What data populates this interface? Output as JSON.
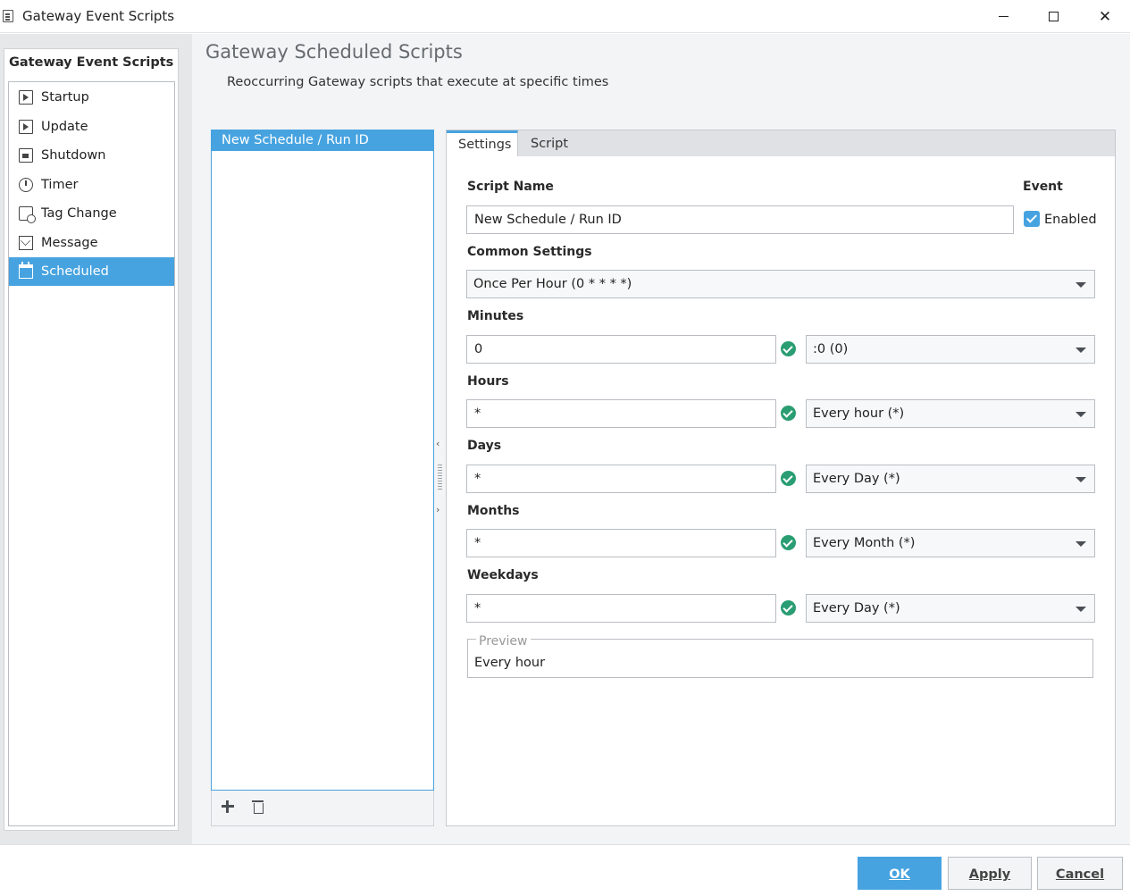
{
  "window": {
    "title": "Gateway Event Scripts",
    "close_glyph": "✕"
  },
  "sidebar": {
    "header": "Gateway Event Scripts",
    "items": [
      {
        "label": "Startup",
        "icon": "play-document-icon"
      },
      {
        "label": "Update",
        "icon": "play-document-icon"
      },
      {
        "label": "Shutdown",
        "icon": "stop-document-icon"
      },
      {
        "label": "Timer",
        "icon": "timer-icon"
      },
      {
        "label": "Tag Change",
        "icon": "tag-icon"
      },
      {
        "label": "Message",
        "icon": "envelope-icon"
      },
      {
        "label": "Scheduled",
        "icon": "calendar-icon",
        "selected": true
      }
    ]
  },
  "header": {
    "title": "Gateway Scheduled Scripts",
    "subtitle": "Reoccurring Gateway scripts that execute at specific times"
  },
  "schedule_list": {
    "items": [
      "New Schedule / Run ID"
    ],
    "toolbar": {
      "add_icon": "plus-icon",
      "delete_icon": "trash-icon"
    }
  },
  "splitter": {
    "left_arrow": "‹",
    "right_arrow": "›"
  },
  "tabs": [
    "Settings",
    "Script"
  ],
  "settings": {
    "script_name_label": "Script Name",
    "script_name_value": "New Schedule / Run ID",
    "event_label": "Event",
    "enabled_label": "Enabled",
    "enabled": true,
    "common_label": "Common Settings",
    "common_value": "Once Per Hour (0 * * * *)",
    "minutes_label": "Minutes",
    "minutes_value": "0",
    "minutes_combo": ":0 (0)",
    "hours_label": "Hours",
    "hours_value": "*",
    "hours_combo": "Every hour (*)",
    "days_label": "Days",
    "days_value": "*",
    "days_combo": "Every Day (*)",
    "months_label": "Months",
    "months_value": "*",
    "months_combo": "Every Month (*)",
    "weekdays_label": "Weekdays",
    "weekdays_value": "*",
    "weekdays_combo": "Every Day (*)",
    "preview_label": "Preview",
    "preview_text": "Every hour"
  },
  "footer": {
    "ok": "OK",
    "apply": "Apply",
    "cancel": "Cancel"
  },
  "colors": {
    "accent": "#47a3e0",
    "valid": "#2a9d73"
  }
}
